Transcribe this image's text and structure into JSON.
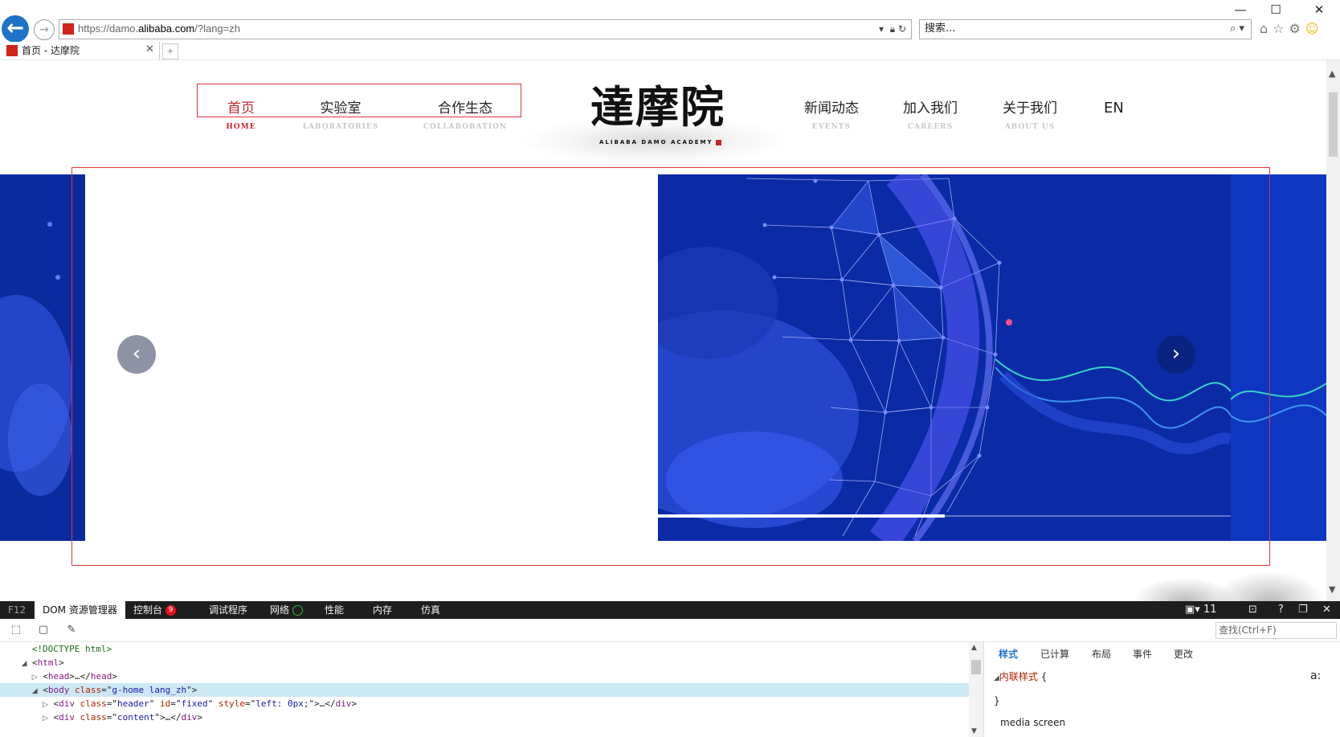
{
  "window": {
    "minimize": "—",
    "maximize": "☐",
    "close": "✕"
  },
  "address": {
    "url_prefix": "https://damo.",
    "url_host": "alibaba.com",
    "url_suffix": "/?lang=zh"
  },
  "search": {
    "placeholder": "搜索..."
  },
  "tab": {
    "title": "首页 - 达摩院"
  },
  "site": {
    "nav_left": [
      {
        "zh": "首页",
        "en": "HOME"
      },
      {
        "zh": "实验室",
        "en": "LABORATORIES"
      },
      {
        "zh": "合作生态",
        "en": "COLLABORATION"
      }
    ],
    "nav_right": [
      {
        "zh": "新闻动态",
        "en": "EVENTS"
      },
      {
        "zh": "加入我们",
        "en": "CAREERS"
      },
      {
        "zh": "关于我们",
        "en": "ABOUT US"
      }
    ],
    "lang_switch": "EN",
    "logo_text": "達摩院",
    "logo_sub": "ALIBABA DAMO ACADEMY",
    "carousel_progress": 0.5
  },
  "devtools": {
    "f12": "F12",
    "tabs": [
      "DOM 资源管理器",
      "控制台",
      "调试程序",
      "网络",
      "性能",
      "内存",
      "仿真"
    ],
    "console_errors": "9",
    "zoom_value": "11",
    "find_placeholder": "查找(Ctrl+F)",
    "style_tabs": [
      "样式",
      "已计算",
      "布局",
      "事件",
      "更改"
    ],
    "inline_styles_label": "内联样式",
    "brace_open": "{",
    "brace_close": "}",
    "media_label": "media screen",
    "dom": [
      {
        "text": "<!DOCTYPE html>"
      },
      {
        "tag": "html"
      },
      {
        "tag": "head",
        "collapsed": "…"
      },
      {
        "tag": "body",
        "attr": "class",
        "val": "g-home lang_zh"
      },
      {
        "tag": "div",
        "attr": "class",
        "val": "header",
        "attr2": "id",
        "val2": "fixed",
        "attr3": "style",
        "val3": "left: 0px;"
      },
      {
        "tag": "div",
        "attr": "class",
        "val": "content"
      }
    ]
  }
}
